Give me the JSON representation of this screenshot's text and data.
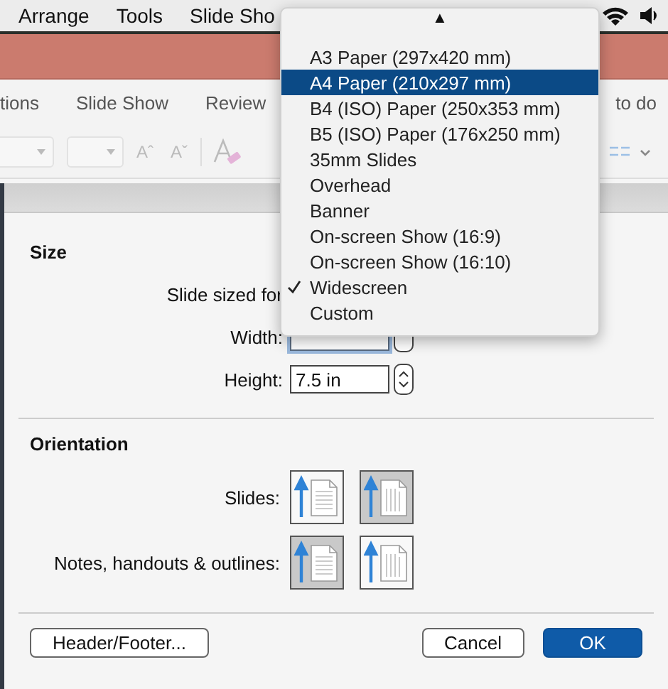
{
  "menu_bar": {
    "items": [
      "Arrange",
      "Tools",
      "Slide Sho"
    ]
  },
  "ribbon": {
    "tabs": [
      "tions",
      "Slide Show",
      "Review",
      "to do"
    ]
  },
  "toolbar": {
    "buttons": [
      "Aˆ",
      "Aˇ"
    ]
  },
  "dialog": {
    "size": {
      "title": "Size",
      "slide_sized_for_label": "Slide sized for",
      "width_label": "Width:",
      "height_label": "Height:",
      "height_value": "7.5 in"
    },
    "orientation": {
      "title": "Orientation",
      "rows": [
        {
          "label": "Slides:",
          "options": [
            {
              "kind": "portrait",
              "selected": false
            },
            {
              "kind": "landscape",
              "selected": true
            }
          ]
        },
        {
          "label": "Notes, handouts & outlines:",
          "options": [
            {
              "kind": "portrait",
              "selected": true
            },
            {
              "kind": "landscape",
              "selected": false
            }
          ]
        }
      ]
    },
    "buttons": [
      {
        "label": "Header/Footer...",
        "kind": "normal"
      },
      {
        "label": "Cancel",
        "kind": "normal"
      },
      {
        "label": "OK",
        "kind": "default"
      }
    ]
  },
  "dropdown": {
    "scroll_arrow": "▲",
    "items": [
      {
        "label": "A3 Paper (297x420 mm)",
        "selected": false,
        "checked": false
      },
      {
        "label": "A4 Paper (210x297 mm)",
        "selected": true,
        "checked": false
      },
      {
        "label": "B4 (ISO) Paper (250x353 mm)",
        "selected": false,
        "checked": false
      },
      {
        "label": "B5 (ISO) Paper (176x250 mm)",
        "selected": false,
        "checked": false
      },
      {
        "label": "35mm Slides",
        "selected": false,
        "checked": false
      },
      {
        "label": "Overhead",
        "selected": false,
        "checked": false
      },
      {
        "label": "Banner",
        "selected": false,
        "checked": false
      },
      {
        "label": "On-screen Show (16:9)",
        "selected": false,
        "checked": false
      },
      {
        "label": "On-screen Show (16:10)",
        "selected": false,
        "checked": false
      },
      {
        "label": "Widescreen",
        "selected": false,
        "checked": true
      },
      {
        "label": "Custom",
        "selected": false,
        "checked": false
      }
    ]
  }
}
